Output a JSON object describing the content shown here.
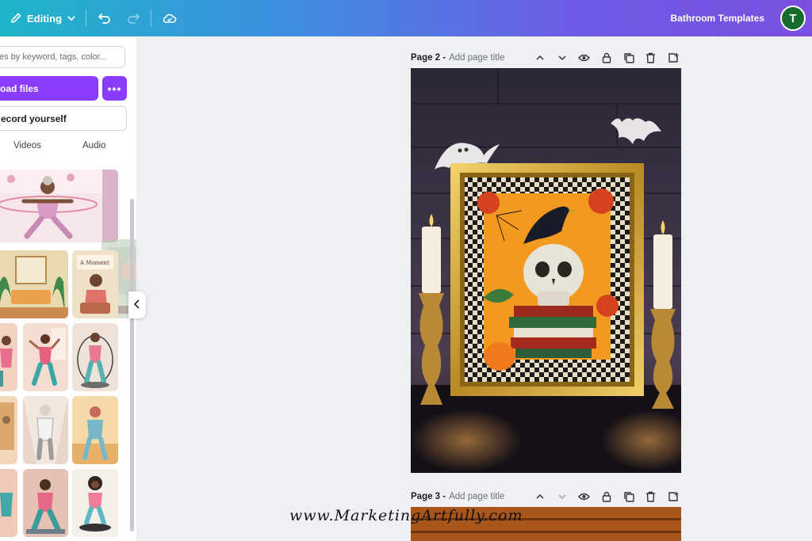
{
  "topbar": {
    "editing_label": "Editing",
    "doc_title": "Bathroom Templates",
    "avatar_initial": "T",
    "colors": {
      "gradient_start": "#1fb5c9",
      "gradient_end": "#7b4fe0"
    }
  },
  "panel": {
    "search_placeholder": "es by keyword, tags, color...",
    "upload_label": "oad files",
    "more_label": "•••",
    "record_label": "ecord yourself",
    "tabs": [
      "Videos",
      "Audio"
    ],
    "accent": "#8b3dff"
  },
  "pages": [
    {
      "title": "Page 2 -",
      "add_title": "Add page title"
    },
    {
      "title": "Page 3 -",
      "add_title": "Add page title"
    }
  ],
  "watermark": "www.MarketingArtfully.com"
}
